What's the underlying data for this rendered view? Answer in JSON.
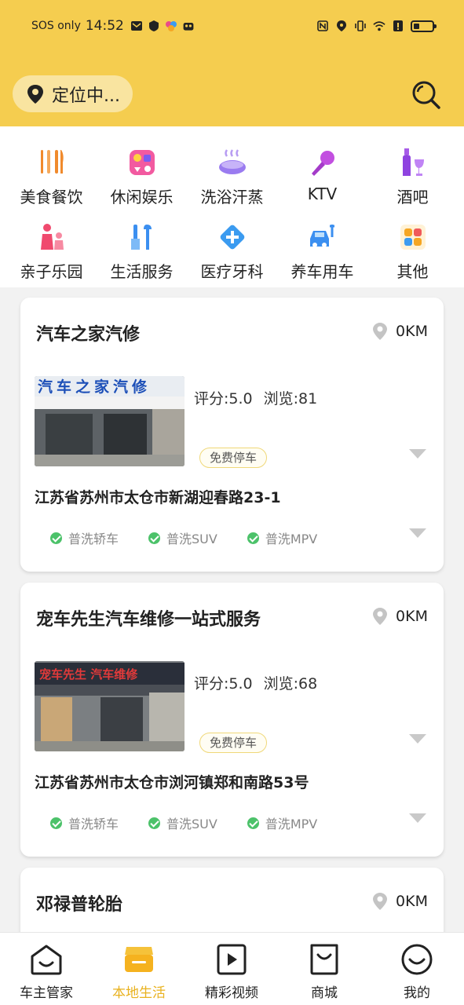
{
  "status_bar": {
    "carrier": "SOS only",
    "time": "14:52"
  },
  "header": {
    "location_label": "定位中..."
  },
  "categories": [
    {
      "label": "美食餐饮",
      "icon": "fork-knife-icon"
    },
    {
      "label": "休闲娱乐",
      "icon": "entertainment-icon"
    },
    {
      "label": "洗浴汗蒸",
      "icon": "bath-icon"
    },
    {
      "label": "KTV",
      "icon": "microphone-icon"
    },
    {
      "label": "酒吧",
      "icon": "wine-icon"
    },
    {
      "label": "亲子乐园",
      "icon": "family-icon"
    },
    {
      "label": "生活服务",
      "icon": "tools-icon"
    },
    {
      "label": "医疗牙科",
      "icon": "medical-icon"
    },
    {
      "label": "养车用车",
      "icon": "car-repair-icon"
    },
    {
      "label": "其他",
      "icon": "grid-icon"
    }
  ],
  "shops": [
    {
      "name": "汽车之家汽修",
      "distance": "0KM",
      "sign_text": "汽车之家汽修",
      "rating": "评分:5.0",
      "views": "浏览:81",
      "tag": "免费停车",
      "address": "江苏省苏州市太仓市新湖迎春路23-1",
      "services": [
        "普洗轿车",
        "普洗SUV",
        "普洗MPV"
      ]
    },
    {
      "name": "宠车先生汽车维修一站式服务",
      "distance": "0KM",
      "sign_text": "宠车先生 汽车维修",
      "rating": "评分:5.0",
      "views": "浏览:68",
      "tag": "免费停车",
      "address": "江苏省苏州市太仓市浏河镇郑和南路53号",
      "services": [
        "普洗轿车",
        "普洗SUV",
        "普洗MPV"
      ]
    },
    {
      "name": "邓禄普轮胎",
      "distance": "0KM"
    }
  ],
  "bottom_nav": [
    {
      "label": "车主管家",
      "active": false
    },
    {
      "label": "本地生活",
      "active": true
    },
    {
      "label": "精彩视频",
      "active": false
    },
    {
      "label": "商城",
      "active": false
    },
    {
      "label": "我的",
      "active": false
    }
  ],
  "colors": {
    "brand_yellow": "#f5cd4f",
    "active_nav": "#e9b21f",
    "check_green": "#4cc26a"
  }
}
